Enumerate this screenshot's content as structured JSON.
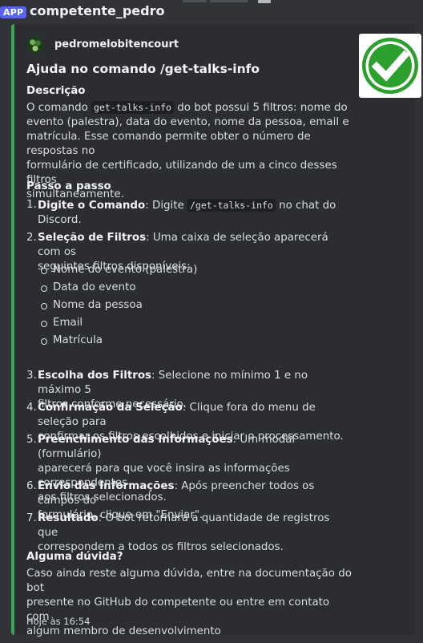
{
  "app_badge": "APP",
  "username": "competente_pedro",
  "embed": {
    "accent_color": "#3ba55c",
    "author": "pedromelobitencourt",
    "title": "Ajuda no comando /get-talks-info",
    "thumbnail_icon": "green-checkmark-icon",
    "descricao": {
      "heading": "Descrição",
      "pre": "O comando ",
      "code": "get-talks-info",
      "line1_post": " do bot possui 5 filtros: nome do",
      "line2": "evento (palestra), data do evento, nome da pessoa, email e",
      "line3": "matrícula. Esse comando permite obter o número de respostas no",
      "line4": "formulário de certificado, utilizando de um a cinco desses filtros",
      "line5": "simultaneamente."
    },
    "passo": {
      "heading": "Passo a passo",
      "step1": {
        "num": "1.",
        "bold": "Digite o Comando",
        "pre": ": Digite ",
        "code": "/get-talks-info",
        "post": " no chat do",
        "line2": "Discord."
      },
      "step2": {
        "num": "2.",
        "bold": "Seleção de Filtros",
        "line1": ": Uma caixa de seleção aparecerá com os",
        "line2": "seguintes filtros disponíveis:"
      },
      "filters": [
        "Nome do evento (palestra)",
        "Data do evento",
        "Nome da pessoa",
        "Email",
        "Matrícula"
      ],
      "step3": {
        "num": "3.",
        "bold": "Escolha dos Filtros",
        "line1": ": Selecione no mínimo 1 e no máximo 5",
        "line2": "filtros conforme necessário."
      },
      "step4": {
        "num": "4.",
        "bold": "Confirmação da Seleção",
        "line1": ": Clique fora do menu de seleção para",
        "line2": "confirmar os filtros escolhidos e iniciar o processamento."
      },
      "step5": {
        "num": "5.",
        "bold": "Preenchimento das Informações",
        "line1": ": Um modal (formulário)",
        "line2": "aparecerá para que você insira as informações correspondentes",
        "line3": "aos filtros selecionados."
      },
      "step6": {
        "num": "6.",
        "bold": "Envio das Informações",
        "line1": ": Após preencher todos os campos do",
        "line2": "formulário, clique em \"Enviar\"."
      },
      "step7": {
        "num": "7.",
        "bold": "Resultado",
        "line1": ": O bot retornará a quantidade de registros que",
        "line2": "correspondem a todos os filtros selecionados."
      }
    },
    "duvida": {
      "heading": "Alguma dúvida?",
      "line1": "Caso ainda reste alguma dúvida, entre na documentação do bot",
      "line2": "presente no GitHub do competente ou entre em contato com",
      "line3": "algum membro de desenvolvimento"
    },
    "timestamp": "Hoje às 16:54"
  }
}
